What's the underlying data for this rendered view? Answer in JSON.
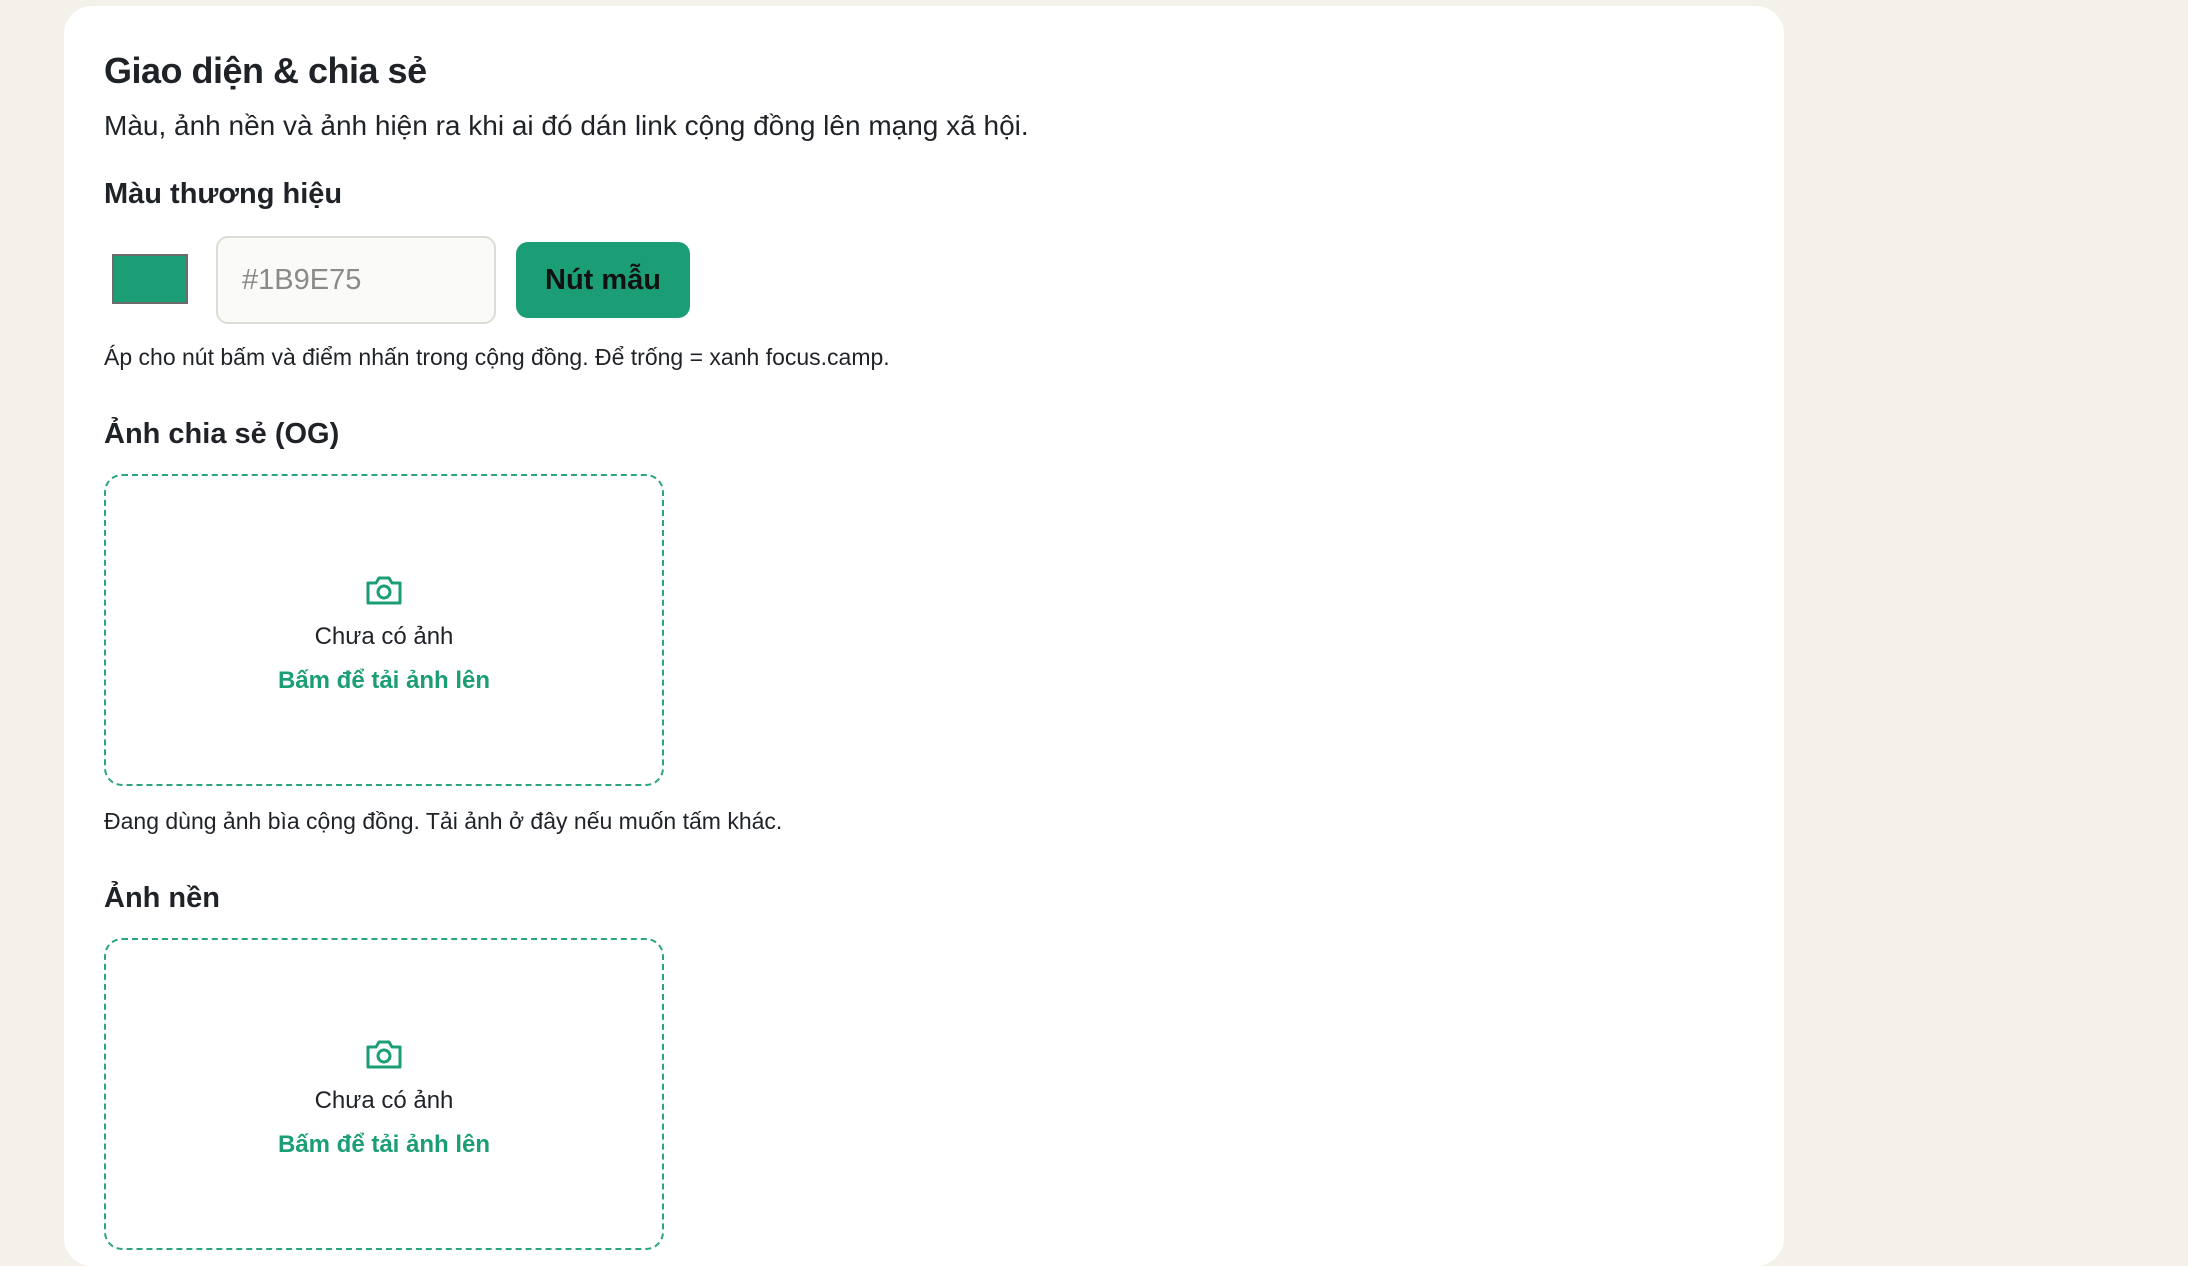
{
  "appearance": {
    "title": "Giao diện & chia sẻ",
    "description": "Màu, ảnh nền và ảnh hiện ra khi ai đó dán link cộng đồng lên mạng xã hội."
  },
  "brand_color": {
    "label": "Màu thương hiệu",
    "swatch_color": "#1B9E75",
    "input_value": "",
    "input_placeholder": "#1B9E75",
    "sample_button_label": "Nút mẫu",
    "hint": "Áp cho nút bấm và điểm nhấn trong cộng đồng. Để trống = xanh focus.camp."
  },
  "og_image": {
    "label": "Ảnh chia sẻ (OG)",
    "icon": "camera-icon",
    "empty_text": "Chưa có ảnh",
    "upload_cta": "Bấm để tải ảnh lên",
    "hint": "Đang dùng ảnh bìa cộng đồng. Tải ảnh ở đây nếu muốn tấm khác."
  },
  "background_image": {
    "label": "Ảnh nền",
    "icon": "camera-icon",
    "empty_text": "Chưa có ảnh",
    "upload_cta": "Bấm để tải ảnh lên"
  },
  "colors": {
    "page_background": "#F3F1E9",
    "card_background": "#FFFFFF",
    "accent": "#1B9E75"
  }
}
